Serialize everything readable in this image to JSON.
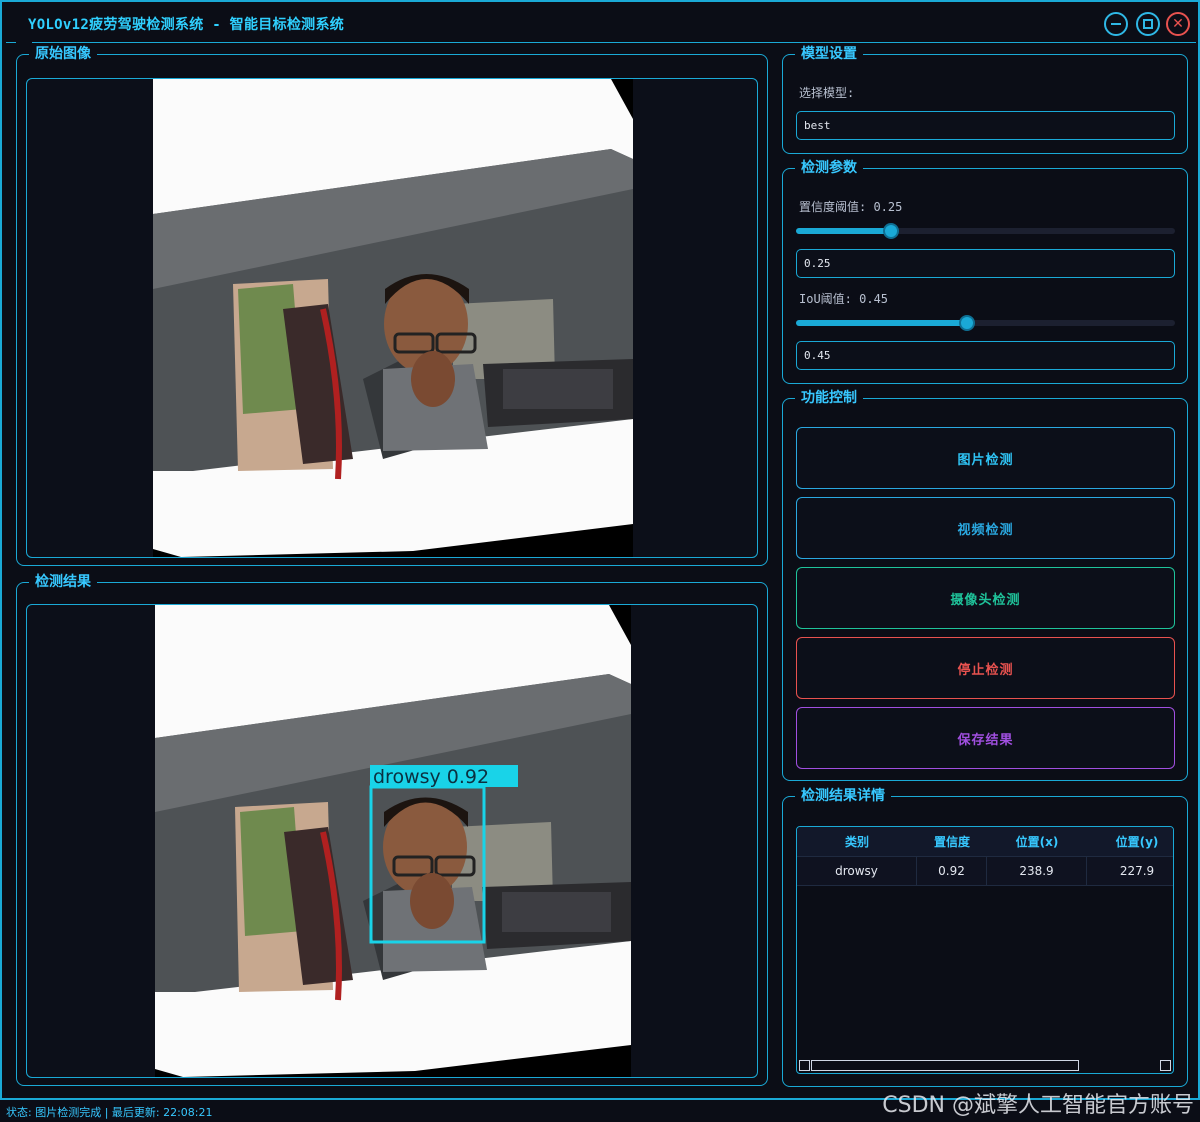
{
  "window": {
    "title": "YOLOv12疲劳驾驶检测系统 - 智能目标检测系统"
  },
  "panels": {
    "original": {
      "title": "原始图像"
    },
    "result": {
      "title": "检测结果"
    }
  },
  "detection_overlay": {
    "label": "drowsy 0.92"
  },
  "model": {
    "title": "模型设置",
    "select_label": "选择模型:",
    "selected": "best"
  },
  "params": {
    "title": "检测参数",
    "conf_label": "置信度阈值: 0.25",
    "conf_value": "0.25",
    "conf_fraction": 0.25,
    "iou_label": "IoU阈值: 0.45",
    "iou_value": "0.45",
    "iou_fraction": 0.45
  },
  "controls": {
    "title": "功能控制",
    "image_detect": "图片检测",
    "video_detect": "视频检测",
    "camera_detect": "摄像头检测",
    "stop_detect": "停止检测",
    "save_result": "保存结果"
  },
  "details": {
    "title": "检测结果详情",
    "columns": [
      "类别",
      "置信度",
      "位置(x)",
      "位置(y)"
    ],
    "rows": [
      [
        "drowsy",
        "0.92",
        "238.9",
        "227.9"
      ]
    ]
  },
  "status": {
    "text": "状态: 图片检测完成 | 最后更新: 22:08:21"
  },
  "watermark": "CSDN @斌擎人工智能官方账号",
  "colors": {
    "accent": "#1aa9d6",
    "title_text": "#37c8ff",
    "image_btn": "#2aa8e0",
    "video_btn": "#2aa8e0",
    "camera_btn": "#1fc39a",
    "stop_btn": "#e8524f",
    "save_btn": "#a14fe0",
    "bbox": "#19d3e8"
  }
}
